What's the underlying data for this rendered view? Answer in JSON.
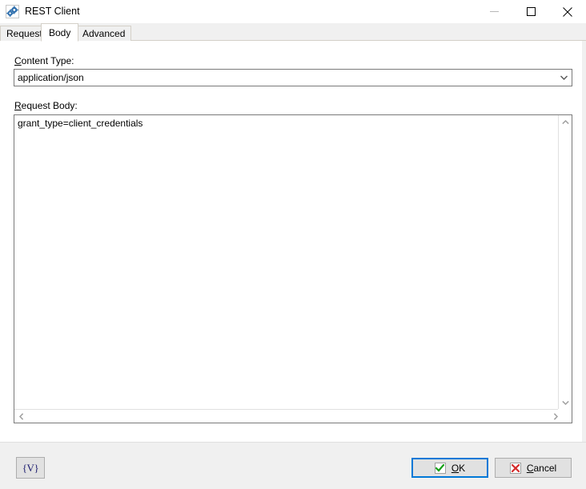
{
  "window": {
    "title": "REST Client",
    "icon": "gears-icon",
    "controls": {
      "minimize": "minimize-icon",
      "maximize": "maximize-icon",
      "close": "close-icon"
    }
  },
  "tabs": [
    {
      "label": "Request",
      "selected": false
    },
    {
      "label": "Body",
      "selected": true
    },
    {
      "label": "Advanced",
      "selected": false
    }
  ],
  "form": {
    "content_type": {
      "label_prefix": "C",
      "label_rest": "ontent Type:",
      "label": "Content Type:",
      "value": "application/json",
      "options": [
        "application/json"
      ]
    },
    "request_body": {
      "label_prefix": "R",
      "label_rest": "equest Body:",
      "label": "Request Body:",
      "value": "grant_type=client_credentials"
    }
  },
  "scrollbars": {
    "vertical_up": "chevron-up-icon",
    "vertical_down": "chevron-down-icon",
    "horizontal_left": "chevron-left-icon",
    "horizontal_right": "chevron-right-icon"
  },
  "footer": {
    "variables_button": {
      "label": "{V}",
      "open_brace": "{",
      "letter": "V",
      "close_brace": "}"
    },
    "ok_button": {
      "label_prefix": "O",
      "label_rest": "K",
      "label": "OK",
      "icon": "green-check-icon"
    },
    "cancel_button": {
      "label_prefix": "C",
      "label_rest": "ancel",
      "label": "Cancel",
      "icon": "red-x-icon"
    }
  },
  "colors": {
    "accent": "#0078d7",
    "panel": "#f0f0f0",
    "border": "#7a7a7a",
    "ok_check": "#15a015",
    "cancel_x": "#d42a2a",
    "icon_blue": "#2f6fad"
  }
}
